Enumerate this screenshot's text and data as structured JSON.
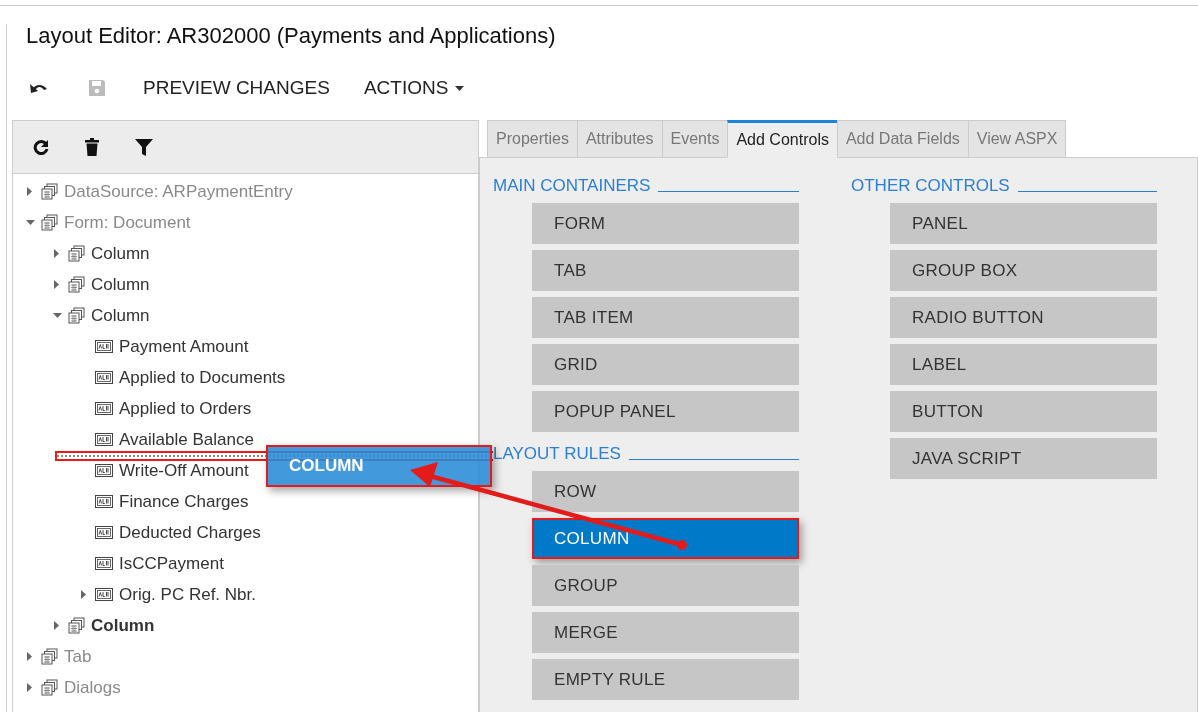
{
  "window": {
    "title": "Layout Editor: AR302000 (Payments and Applications)"
  },
  "toolbar": {
    "buttons": [
      {
        "kind": "undo",
        "disabled": false
      },
      {
        "kind": "save",
        "disabled": true
      },
      {
        "kind": "text",
        "label": "PREVIEW CHANGES",
        "disabled": false
      },
      {
        "kind": "menu",
        "label": "ACTIONS",
        "disabled": false
      }
    ]
  },
  "tree_toolbar": [
    {
      "kind": "refresh"
    },
    {
      "kind": "delete"
    },
    {
      "kind": "filter"
    }
  ],
  "tree": [
    {
      "label": "DataSource: ARPaymentEntry",
      "kind": "container",
      "expanded": false,
      "dimmed": true,
      "bold": false
    },
    {
      "label": "Form: Document",
      "kind": "container",
      "expanded": true,
      "dimmed": true,
      "bold": false,
      "children": [
        {
          "label": "Column",
          "kind": "container",
          "expanded": false,
          "dimmed": false,
          "bold": false
        },
        {
          "label": "Column",
          "kind": "container",
          "expanded": false,
          "dimmed": false,
          "bold": false
        },
        {
          "label": "Column",
          "kind": "container",
          "expanded": true,
          "dimmed": false,
          "bold": false,
          "children": [
            {
              "label": "Payment Amount",
              "kind": "field",
              "dimmed": false,
              "bold": false
            },
            {
              "label": "Applied to Documents",
              "kind": "field",
              "dimmed": false,
              "bold": false
            },
            {
              "label": "Applied to Orders",
              "kind": "field",
              "dimmed": false,
              "bold": false
            },
            {
              "label": "Available Balance",
              "kind": "field",
              "dimmed": false,
              "bold": false
            },
            {
              "label": "Write-Off Amount",
              "kind": "field",
              "dimmed": false,
              "bold": false
            },
            {
              "label": "Finance Charges",
              "kind": "field",
              "dimmed": false,
              "bold": false
            },
            {
              "label": "Deducted Charges",
              "kind": "field",
              "dimmed": false,
              "bold": false
            },
            {
              "label": "IsCCPayment",
              "kind": "field",
              "dimmed": false,
              "bold": false
            },
            {
              "label": "Orig. PC Ref. Nbr.",
              "kind": "field",
              "expanded": false,
              "dimmed": false,
              "bold": false
            }
          ]
        },
        {
          "label": "Column",
          "kind": "container",
          "expanded": false,
          "dimmed": false,
          "bold": true
        }
      ]
    },
    {
      "label": "Tab",
      "kind": "container",
      "expanded": false,
      "dimmed": true,
      "bold": false
    },
    {
      "label": "Dialogs",
      "kind": "container",
      "expanded": false,
      "dimmed": true,
      "bold": false
    }
  ],
  "tabs": [
    {
      "label": "Properties",
      "selected": false
    },
    {
      "label": "Attributes",
      "selected": false
    },
    {
      "label": "Events",
      "selected": false
    },
    {
      "label": "Add Controls",
      "selected": true
    },
    {
      "label": "Add Data Fields",
      "selected": false
    },
    {
      "label": "View ASPX",
      "selected": false
    }
  ],
  "columns": [
    {
      "sections": [
        {
          "title": "MAIN CONTAINERS",
          "items": [
            {
              "label": "FORM",
              "selected": false
            },
            {
              "label": "TAB",
              "selected": false
            },
            {
              "label": "TAB ITEM",
              "selected": false
            },
            {
              "label": "GRID",
              "selected": false
            },
            {
              "label": "POPUP PANEL",
              "selected": false
            }
          ]
        },
        {
          "title": "LAYOUT RULES",
          "items": [
            {
              "label": "ROW",
              "selected": false
            },
            {
              "label": "COLUMN",
              "selected": true
            },
            {
              "label": "GROUP",
              "selected": false
            },
            {
              "label": "MERGE",
              "selected": false
            },
            {
              "label": "EMPTY RULE",
              "selected": false
            }
          ]
        }
      ]
    },
    {
      "sections": [
        {
          "title": "OTHER CONTROLS",
          "items": [
            {
              "label": "PANEL",
              "selected": false
            },
            {
              "label": "GROUP BOX",
              "selected": false
            },
            {
              "label": "RADIO BUTTON",
              "selected": false
            },
            {
              "label": "LABEL",
              "selected": false
            },
            {
              "label": "BUTTON",
              "selected": false
            },
            {
              "label": "JAVA SCRIPT",
              "selected": false
            }
          ]
        }
      ]
    }
  ],
  "drag_ghost": {
    "label": "COLUMN"
  }
}
